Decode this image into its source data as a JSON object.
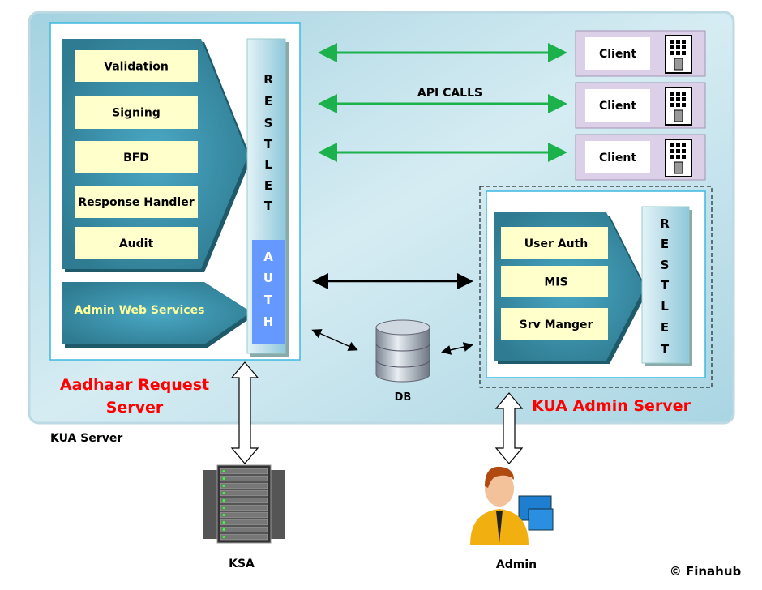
{
  "kua_server": {
    "label": "KUA Server",
    "aadhaar_request_server": {
      "title_line1": "Aadhaar Request",
      "title_line2": "Server",
      "modules": [
        "Validation",
        "Signing",
        "BFD",
        "Response Handler",
        "Audit"
      ],
      "admin_web_services": "Admin Web Services",
      "restlet_letters": [
        "R",
        "E",
        "S",
        "T",
        "L",
        "E",
        "T"
      ],
      "auth_letters": [
        "A",
        "U",
        "T",
        "H"
      ]
    },
    "api_calls_label": "API CALLS",
    "clients": [
      "Client",
      "Client",
      "Client"
    ],
    "db_label": "DB",
    "kua_admin_server": {
      "title": "KUA Admin Server",
      "modules": [
        "User Auth",
        "MIS",
        "Srv Manger"
      ],
      "restlet_letters": [
        "R",
        "E",
        "S",
        "T",
        "L",
        "E",
        "T"
      ]
    }
  },
  "ksa_label": "KSA",
  "admin_label": "Admin",
  "copyright": "© Finahub",
  "colors": {
    "module_fill": "#ffffcc",
    "teal": "#3a8aa0",
    "auth_blue": "#6699ff",
    "api_arrow_green": "#1bb24b",
    "title_red": "#ff0000",
    "client_box": "#dcd0e8"
  }
}
